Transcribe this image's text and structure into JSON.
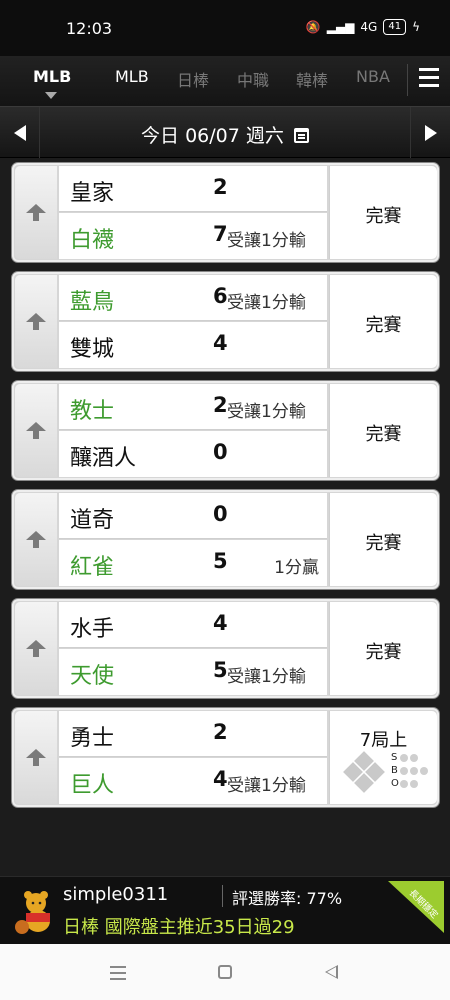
{
  "status_bar": {
    "time": "12:03",
    "battery": "41",
    "signal_text": "4G"
  },
  "tabs": {
    "active_label": "MLB",
    "items": [
      {
        "label": "MLB",
        "state": "highlighted"
      },
      {
        "label": "日棒",
        "state": "inactive"
      },
      {
        "label": "中職",
        "state": "inactive"
      },
      {
        "label": "韓棒",
        "state": "inactive"
      },
      {
        "label": "NBA",
        "state": "inactive"
      }
    ]
  },
  "date_bar": {
    "label": "今日 06/07 週六"
  },
  "games": [
    {
      "status": "完賽",
      "top": {
        "team": "皇家",
        "color": "black",
        "score": "2",
        "note": ""
      },
      "bottom": {
        "team": "白襪",
        "color": "green",
        "score": "7",
        "note": "受讓1分輸"
      }
    },
    {
      "status": "完賽",
      "top": {
        "team": "藍鳥",
        "color": "green",
        "score": "6",
        "note": "受讓1分輸"
      },
      "bottom": {
        "team": "雙城",
        "color": "black",
        "score": "4",
        "note": ""
      }
    },
    {
      "status": "完賽",
      "top": {
        "team": "教士",
        "color": "green",
        "score": "2",
        "note": "受讓1分輸"
      },
      "bottom": {
        "team": "釀酒人",
        "color": "black",
        "score": "0",
        "note": ""
      }
    },
    {
      "status": "完賽",
      "top": {
        "team": "道奇",
        "color": "black",
        "score": "0",
        "note": ""
      },
      "bottom": {
        "team": "紅雀",
        "color": "green",
        "score": "5",
        "note": "1分贏"
      }
    },
    {
      "status": "完賽",
      "top": {
        "team": "水手",
        "color": "black",
        "score": "4",
        "note": ""
      },
      "bottom": {
        "team": "天使",
        "color": "green",
        "score": "5",
        "note": "受讓1分輸"
      }
    },
    {
      "status": "7局上",
      "live": true,
      "sbo_labels": [
        "S",
        "B",
        "O"
      ],
      "top": {
        "team": "勇士",
        "color": "black",
        "score": "2",
        "note": ""
      },
      "bottom": {
        "team": "巨人",
        "color": "green",
        "score": "4",
        "note": "受讓1分輸"
      }
    }
  ],
  "ad": {
    "username": "simple0311",
    "win_rate": "評選勝率: 77%",
    "promo": "日棒 國際盤主推近35日過29",
    "badge": "長期穩定"
  },
  "colors": {
    "green_team": "#3e9b2f",
    "promo_text": "#c8e84a",
    "badge": "#9ccc2f"
  }
}
